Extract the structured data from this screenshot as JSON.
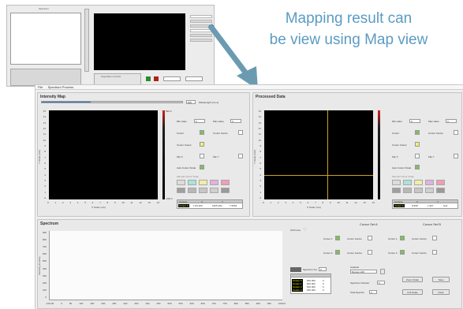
{
  "caption": {
    "line1": "Mapping result can",
    "line2": "be view using Map view"
  },
  "colors": {
    "caption": "#5b9bc3",
    "arrow": "#6b9bb1",
    "plot_background": "#000000",
    "accent": "#3b73c7",
    "crosshair": "#c8a424"
  },
  "inset": {
    "left_panel_title": "Spectrum",
    "toolbar_icons": [
      "zoom-icon",
      "pan-icon",
      "cursor-icon",
      "grid-icon",
      "export-icon",
      "settings-icon"
    ],
    "acquisition_title": "Acquisition Control"
  },
  "map_view": {
    "menu": [
      "File",
      "Spectrum Process"
    ],
    "intensity_map": {
      "title": "Intensity Map",
      "slider_value": "600",
      "slider_label": "Wavelength (cm-1)",
      "slider_fraction": 0.35,
      "x_ticks": [
        "0",
        "1",
        "2",
        "3",
        "4",
        "5",
        "6",
        "7",
        "8",
        "9",
        "10",
        "11",
        "12",
        "13",
        "14"
      ],
      "y_ticks": [
        "15",
        "14",
        "13",
        "12",
        "11",
        "10",
        "9",
        "8",
        "7",
        "6",
        "5",
        "4",
        "3",
        "2",
        "1",
        "0"
      ],
      "x_label": "X Scale (mm)",
      "y_label": "Y Scale (mm)",
      "colorbar_max": "532.4",
      "colorbar_min": "-100.4",
      "controls": {
        "min_value_label": "Min value",
        "max_value_label": "Max value",
        "min_value": "0",
        "max_value": "0",
        "cursor": "Cursor",
        "cursor_centre": "Cursor Centre",
        "cursor_colour": "Cursor Colour",
        "flip_x": "Flip X",
        "flip_y": "Flip Y",
        "auto_colour_scale": "Auto Colour Scale",
        "manual_colour_scale": "Manual Colour Scale"
      },
      "cursor_table": {
        "headers": [
          "Cursors",
          "X",
          "Y"
        ],
        "row": [
          "Cursor 0",
          "1.83,484",
          "1825.484",
          "7.5953"
        ]
      }
    },
    "processed_data": {
      "title": "Processed Data",
      "x_ticks": [
        "0",
        "1",
        "2",
        "3",
        "4",
        "5",
        "6",
        "7",
        "8",
        "9",
        "10",
        "11",
        "12",
        "13",
        "14"
      ],
      "y_ticks": [
        "15",
        "14",
        "13",
        "12",
        "11",
        "10",
        "9",
        "8",
        "7",
        "6",
        "5",
        "4",
        "3",
        "2",
        "1",
        "0"
      ],
      "x_label": "X Scale (mm)",
      "y_label": "Y Scale (mm)",
      "crosshair_x_fraction": 0.58,
      "crosshair_y_fraction": 0.73,
      "controls": {
        "min_value_label": "Min value",
        "max_value_label": "Max value",
        "min_value": "0",
        "max_value": "0",
        "cursor": "Cursor",
        "cursor_centre": "Cursor Centre",
        "cursor_colour": "Cursor Colour",
        "flip_x": "Flip X",
        "flip_y": "Flip Y",
        "auto_colour_scale": "Auto Colour Scale",
        "manual_colour_scale": "Manual Colour Scale"
      },
      "cursor_table": {
        "headers": [
          "Cursors",
          "X",
          "Y"
        ],
        "row": [
          "Cursor 0",
          "8.998",
          "1.967",
          "Null"
        ]
      }
    },
    "spectrum": {
      "title": "Spectrum",
      "y_label": "Intensity (Counts)",
      "x_label": "Wavenumber (cm-1)",
      "x_ticks": [
        "-100.00",
        "0",
        "50",
        "100",
        "150",
        "200",
        "250",
        "300",
        "350",
        "400",
        "450",
        "500",
        "550",
        "600",
        "650",
        "700",
        "750",
        "800",
        "850",
        "900",
        "950",
        "1000.0"
      ],
      "y_ticks": [
        "900",
        "800",
        "700",
        "600",
        "500",
        "400",
        "300",
        "200",
        "100",
        "0"
      ],
      "ccd_label": "CCD Line",
      "cursor_set_a": "Cursor Set A",
      "cursor_set_b": "Cursor Set B",
      "cursor_1": "Cursor 1",
      "cursor_2": "Cursor 2",
      "cursor_centre": "Cursor Centre",
      "spectrum_no_label": "Spectrum No.",
      "spectrum_no": "0",
      "analysis_label": "Analysis",
      "analysis_value": "Raman shift",
      "spectrum_number_label": "Spectrum Number",
      "spectrum_number": "0",
      "total_spectra_label": "Total Spectra",
      "total_spectra": "0",
      "buttons": [
        "Zoom Scale",
        "Save",
        "Full Scale",
        "Clear"
      ],
      "table_rows": [
        [
          "Cursor 0",
          "600.000",
          "0"
        ],
        [
          "Cursor 1",
          "600.000",
          "0"
        ],
        [
          "Cursor 2",
          "600.000",
          "0"
        ],
        [
          "Cursor 3",
          "600.000",
          "0"
        ]
      ]
    }
  }
}
